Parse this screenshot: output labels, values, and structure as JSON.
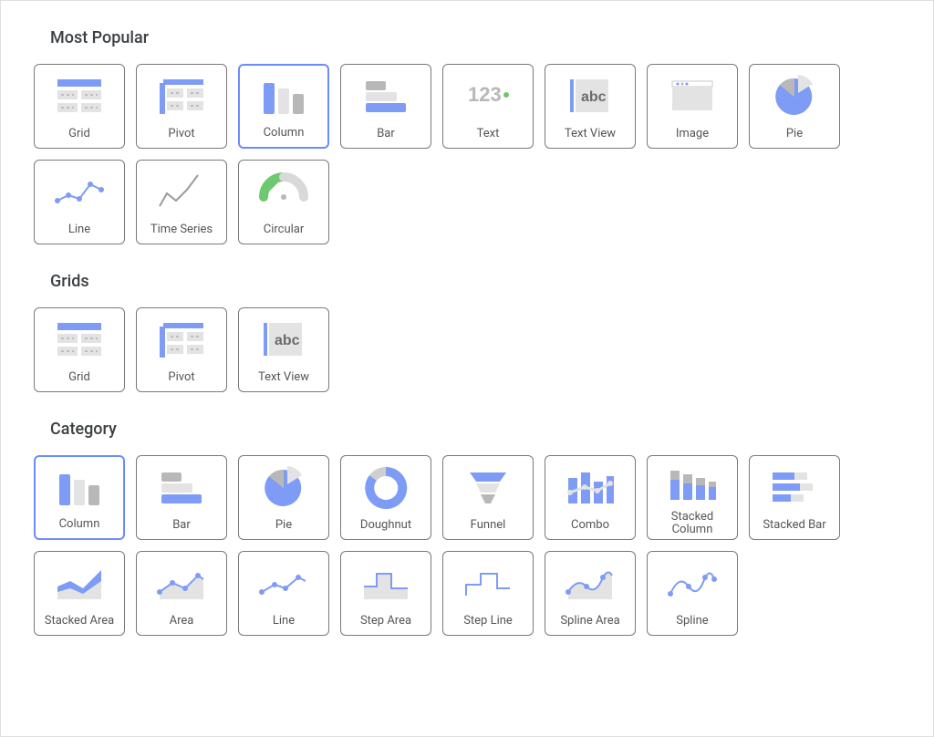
{
  "sections": [
    {
      "id": "most-popular",
      "title": "Most Popular",
      "items": [
        {
          "icon": "grid",
          "label": "Grid",
          "selected": false
        },
        {
          "icon": "pivot",
          "label": "Pivot",
          "selected": false
        },
        {
          "icon": "column",
          "label": "Column",
          "selected": true
        },
        {
          "icon": "bar",
          "label": "Bar",
          "selected": false
        },
        {
          "icon": "text",
          "label": "Text",
          "selected": false
        },
        {
          "icon": "textview",
          "label": "Text View",
          "selected": false
        },
        {
          "icon": "image",
          "label": "Image",
          "selected": false
        },
        {
          "icon": "pie",
          "label": "Pie",
          "selected": false
        },
        {
          "icon": "line",
          "label": "Line",
          "selected": false
        },
        {
          "icon": "timeseries",
          "label": "Time Series",
          "selected": false
        },
        {
          "icon": "circular",
          "label": "Circular",
          "selected": false
        }
      ]
    },
    {
      "id": "grids",
      "title": "Grids",
      "items": [
        {
          "icon": "grid",
          "label": "Grid",
          "selected": false
        },
        {
          "icon": "pivot",
          "label": "Pivot",
          "selected": false
        },
        {
          "icon": "textview",
          "label": "Text View",
          "selected": false
        }
      ]
    },
    {
      "id": "category",
      "title": "Category",
      "items": [
        {
          "icon": "column",
          "label": "Column",
          "selected": true
        },
        {
          "icon": "bar",
          "label": "Bar",
          "selected": false
        },
        {
          "icon": "pie",
          "label": "Pie",
          "selected": false
        },
        {
          "icon": "doughnut",
          "label": "Doughnut",
          "selected": false
        },
        {
          "icon": "funnel",
          "label": "Funnel",
          "selected": false
        },
        {
          "icon": "combo",
          "label": "Combo",
          "selected": false
        },
        {
          "icon": "stackedcolumn",
          "label": "Stacked Column",
          "selected": false
        },
        {
          "icon": "stackedbar",
          "label": "Stacked Bar",
          "selected": false
        },
        {
          "icon": "stackedarea",
          "label": "Stacked Area",
          "selected": false
        },
        {
          "icon": "area",
          "label": "Area",
          "selected": false
        },
        {
          "icon": "line2",
          "label": "Line",
          "selected": false
        },
        {
          "icon": "steparea",
          "label": "Step Area",
          "selected": false
        },
        {
          "icon": "stepline",
          "label": "Step Line",
          "selected": false
        },
        {
          "icon": "splinearea",
          "label": "Spline Area",
          "selected": false
        },
        {
          "icon": "spline",
          "label": "Spline",
          "selected": false
        }
      ]
    }
  ]
}
